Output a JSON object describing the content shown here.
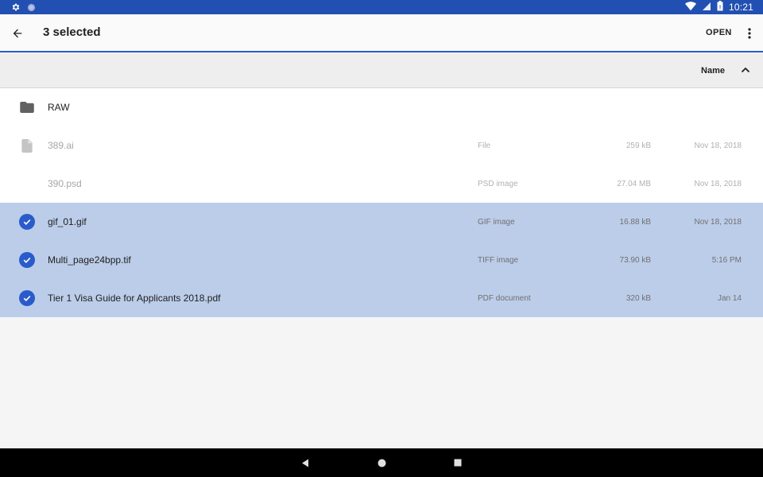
{
  "status_bar": {
    "time": "10:21",
    "left_icons": [
      "settings-icon",
      "circle-notification-icon"
    ],
    "right_icons": [
      "wifi-icon",
      "no-sim-icon",
      "battery-icon"
    ]
  },
  "app_bar": {
    "title": "3 selected",
    "open_label": "OPEN",
    "accent_color": "#2a5bcb"
  },
  "sort": {
    "label": "Name",
    "direction": "ascending"
  },
  "files": [
    {
      "name": "RAW",
      "type": "",
      "size": "",
      "date": "",
      "icon": "folder-icon",
      "selected": false,
      "disabled": false
    },
    {
      "name": "389.ai",
      "type": "File",
      "size": "259 kB",
      "date": "Nov 18, 2018",
      "icon": "file-icon",
      "selected": false,
      "disabled": true
    },
    {
      "name": "390.psd",
      "type": "PSD image",
      "size": "27.04 MB",
      "date": "Nov 18, 2018",
      "icon": "",
      "selected": false,
      "disabled": true
    },
    {
      "name": "gif_01.gif",
      "type": "GIF image",
      "size": "16.88 kB",
      "date": "Nov 18, 2018",
      "icon": "check-circle-icon",
      "selected": true,
      "disabled": false
    },
    {
      "name": "Multi_page24bpp.tif",
      "type": "TIFF image",
      "size": "73.90 kB",
      "date": "5:16 PM",
      "icon": "check-circle-icon",
      "selected": true,
      "disabled": false
    },
    {
      "name": "Tier 1 Visa Guide for Applicants 2018.pdf",
      "type": "PDF document",
      "size": "320 kB",
      "date": "Jan 14",
      "icon": "check-circle-icon",
      "selected": true,
      "disabled": false
    }
  ],
  "colors": {
    "status_bar": "#2250b2",
    "selected_row": "#bccde9",
    "check": "#2a5bcb"
  }
}
